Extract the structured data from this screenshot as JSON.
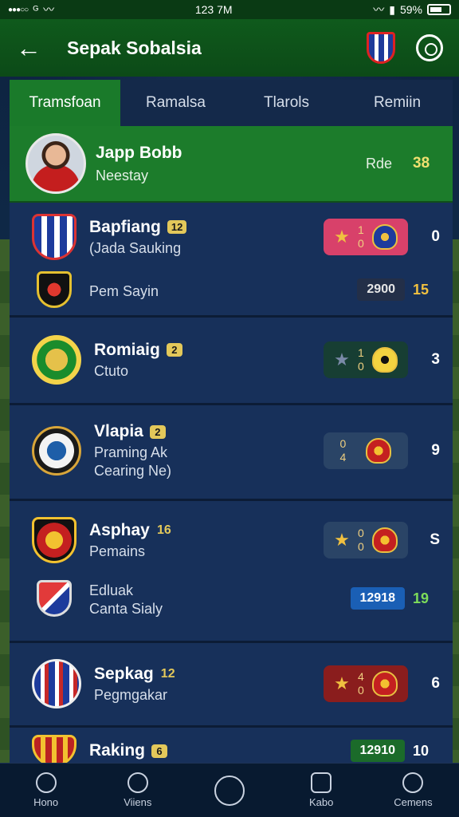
{
  "status_bar": {
    "time": "123 7M",
    "battery": "59%",
    "network": "ᴳ"
  },
  "header": {
    "title": "Sepak Sobalsia"
  },
  "tabs": [
    "Tramsfoan",
    "Ramalsa",
    "Tlarols",
    "Remiin"
  ],
  "player": {
    "name": "Japp Bobb",
    "sub": "Neestay",
    "label": "Rde",
    "value": "38"
  },
  "sections": [
    {
      "rows": [
        {
          "name": "Bapfiang",
          "badge": "12",
          "sub": "(Jada Sauking",
          "box_top": "1",
          "box_bottom": "0",
          "right": "0"
        },
        {
          "name": "",
          "sub": "Pem Sayin",
          "pill": "2900",
          "val": "15"
        }
      ]
    },
    {
      "rows": [
        {
          "name": "Romiaig",
          "badge": "2",
          "sub": "Ctuto",
          "box_top": "1",
          "box_bottom": "0",
          "right": "3"
        }
      ]
    },
    {
      "rows": [
        {
          "name": "Vlapia",
          "badge": "2",
          "sub": "Praming Ak",
          "sub2": "Cearing Ne)",
          "box_top": "0",
          "box_bottom": "4",
          "right": "9"
        }
      ]
    },
    {
      "rows": [
        {
          "name": "Asphay",
          "badge": "16",
          "sub": "Pemains",
          "box_top": "0",
          "box_bottom": "0",
          "right": "S"
        },
        {
          "name": "",
          "sub": "Edluak",
          "sub2": "Canta Sialy",
          "pill": "12918",
          "val": "19"
        }
      ]
    },
    {
      "rows": [
        {
          "name": "Sepkag",
          "badge": "12",
          "sub": "Pegmgakar",
          "box_top": "4",
          "box_bottom": "0",
          "right": "6"
        }
      ]
    },
    {
      "rows": [
        {
          "name": "Raking",
          "badge": "6",
          "pill": "12910",
          "val": "10"
        }
      ]
    }
  ],
  "bottom_nav": [
    "Hono",
    "Viiens",
    "",
    "Kabo",
    "Cemens"
  ]
}
